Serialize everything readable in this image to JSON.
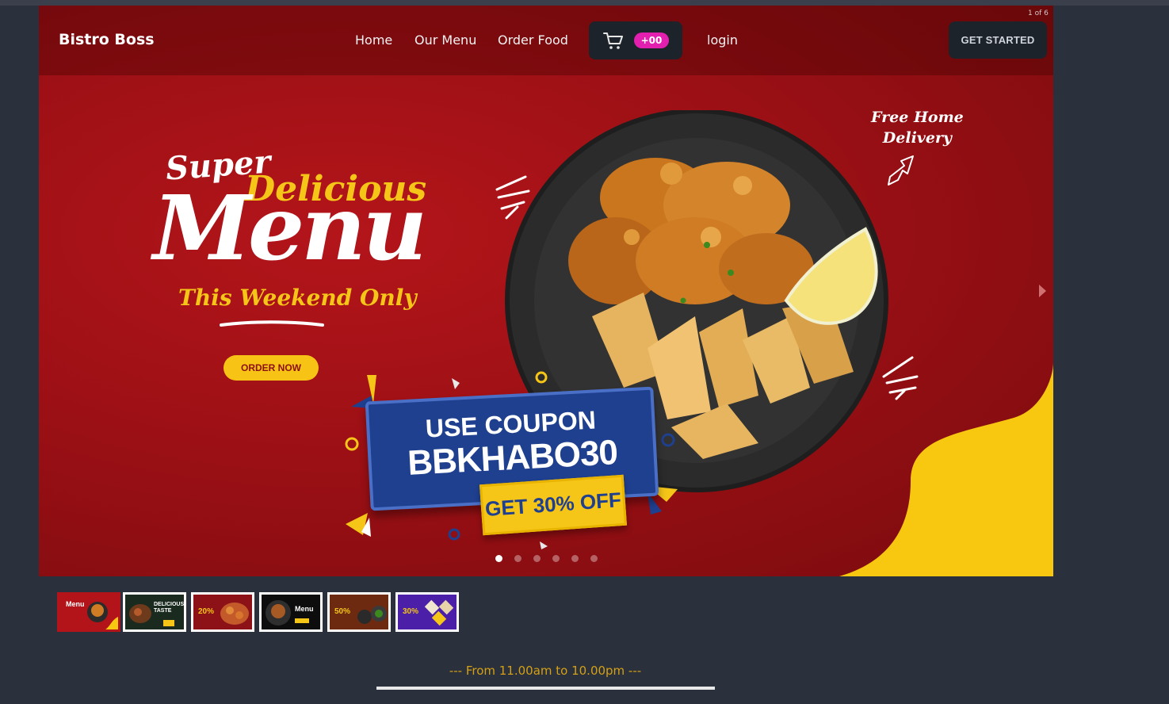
{
  "nav": {
    "brand": "Bistro Boss",
    "links": [
      "Home",
      "Our Menu",
      "Order Food",
      "login"
    ],
    "cart_badge": "+00",
    "cta_label": "GET STARTED"
  },
  "carousel": {
    "counter": "1 of 6",
    "active_index": 0,
    "slide_count": 6,
    "slide": {
      "headline_super": "Super",
      "headline_delicious": "Delicious",
      "headline_menu": "Menu",
      "headline_weekend": "This Weekend Only",
      "order_button": "ORDER NOW",
      "free_delivery_1": "Free Home",
      "free_delivery_2": "Delivery",
      "coupon_use": "USE COUPON",
      "coupon_code": "BBKHABO30",
      "coupon_off": "GET 30% OFF"
    },
    "thumbs": [
      {
        "title": "Menu",
        "bg": "#b3141a",
        "accent": "#f5c518"
      },
      {
        "title": "DELICIOUS TASTE",
        "bg": "#1a2a1f",
        "accent": "#f5c518"
      },
      {
        "title": "20%",
        "bg": "#8c1218",
        "accent": "#f5c518"
      },
      {
        "title": "Menu",
        "bg": "#0d0d0d",
        "accent": "#f5c518"
      },
      {
        "title": "50%",
        "bg": "#6e2a10",
        "accent": "#f5c518"
      },
      {
        "title": "30%",
        "bg": "#4b1fa8",
        "accent": "#f5c518"
      }
    ]
  },
  "footer": {
    "hours": "--- From 11.00am to 10.00pm ---"
  },
  "colors": {
    "page_bg": "#2a303c",
    "banner_red": "#9c1015",
    "accent_yellow": "#f5c518",
    "badge_pink": "#e31fb0",
    "coupon_blue": "#1f3f8f",
    "hours_gold": "#d4a015"
  }
}
